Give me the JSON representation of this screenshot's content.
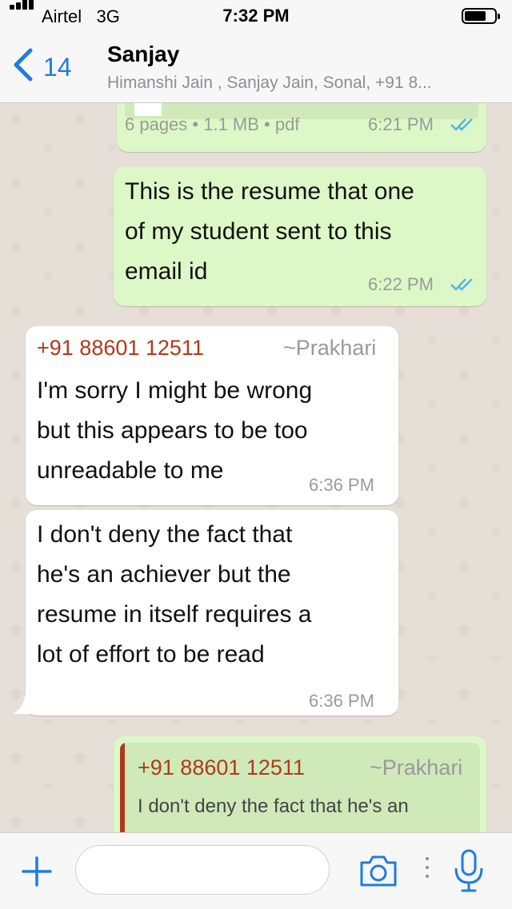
{
  "status_bar": {
    "carrier": "Airtel",
    "network": "3G",
    "time": "7:32 PM",
    "battery_level": 0.72
  },
  "header": {
    "back_count": "14",
    "title": "Sanjay",
    "subtitle": "Himanshi Jain , Sanjay Jain, Sonal, +91 8..."
  },
  "messages": [
    {
      "type": "outgoing-document",
      "meta": "6 pages • 1.1 MB • pdf",
      "time": "6:21 PM",
      "read": true
    },
    {
      "type": "outgoing",
      "lines": [
        "This is the resume that one",
        "of my student sent to this",
        "email id"
      ],
      "time": "6:22 PM",
      "read": true
    },
    {
      "type": "incoming",
      "sender": "+91 88601 12511",
      "alias": "~Prakhari",
      "lines": [
        "I'm sorry  I might be wrong",
        "but this appears to be too",
        "unreadable to me"
      ],
      "time": "6:36 PM"
    },
    {
      "type": "incoming",
      "lines": [
        "I don't deny the fact that",
        "he's an achiever but the",
        "resume in itself requires a",
        "lot of effort to be read"
      ],
      "time": "6:36 PM"
    },
    {
      "type": "outgoing-reply",
      "quote_sender": "+91 88601 12511",
      "quote_alias": "~Prakhari",
      "quote_text": "I don't deny the fact that he's an"
    }
  ],
  "composer": {
    "placeholder": ""
  },
  "colors": {
    "accent": "#1f7ce0",
    "outgoing_bubble": "#dcf8c6",
    "incoming_bubble": "#ffffff",
    "sender_name": "#b0391b",
    "read_ticks": "#4fb6ec"
  },
  "icons": [
    "signal-icon",
    "battery-icon",
    "back-chevron-icon",
    "read-ticks-icon",
    "plus-icon",
    "camera-icon",
    "mic-icon"
  ]
}
